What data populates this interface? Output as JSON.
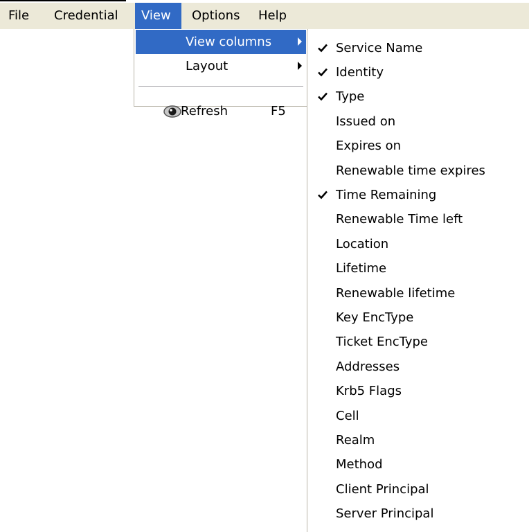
{
  "menubar": {
    "items": [
      "File",
      "Credential",
      "View",
      "Options",
      "Help"
    ],
    "active": "View"
  },
  "view_menu": {
    "items": [
      {
        "label": "View columns",
        "has_submenu": true,
        "highlighted": true
      },
      {
        "label": "Layout",
        "has_submenu": true,
        "highlighted": false
      },
      {
        "label": "Refresh",
        "shortcut": "F5",
        "icon": "refresh-eye-icon"
      }
    ]
  },
  "columns_menu": {
    "items": [
      {
        "label": "Service Name",
        "checked": true
      },
      {
        "label": "Identity",
        "checked": true
      },
      {
        "label": "Type",
        "checked": true
      },
      {
        "label": "Issued on",
        "checked": false
      },
      {
        "label": "Expires on",
        "checked": false
      },
      {
        "label": "Renewable time expires",
        "checked": false
      },
      {
        "label": "Time Remaining",
        "checked": true
      },
      {
        "label": "Renewable Time left",
        "checked": false
      },
      {
        "label": "Location",
        "checked": false
      },
      {
        "label": "Lifetime",
        "checked": false
      },
      {
        "label": "Renewable lifetime",
        "checked": false
      },
      {
        "label": "Key EncType",
        "checked": false
      },
      {
        "label": "Ticket EncType",
        "checked": false
      },
      {
        "label": "Addresses",
        "checked": false
      },
      {
        "label": "Krb5 Flags",
        "checked": false
      },
      {
        "label": "Cell",
        "checked": false
      },
      {
        "label": "Realm",
        "checked": false
      },
      {
        "label": "Method",
        "checked": false
      },
      {
        "label": "Client Principal",
        "checked": false
      },
      {
        "label": "Server Principal",
        "checked": false
      }
    ]
  },
  "colors": {
    "menubar_bg": "#ece9d8",
    "highlight": "#316ac5",
    "menu_bg": "#ffffff",
    "menu_border": "#b8b4a8"
  }
}
